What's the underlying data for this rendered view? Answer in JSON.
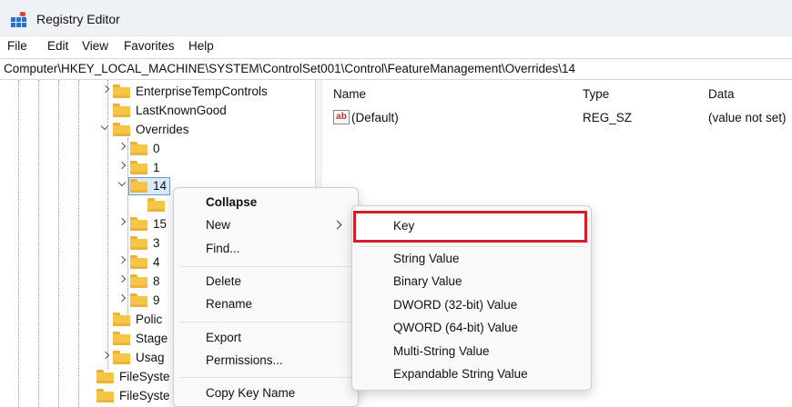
{
  "window": {
    "title": "Registry Editor"
  },
  "menu": [
    "File",
    "Edit",
    "View",
    "Favorites",
    "Help"
  ],
  "address": "Computer\\HKEY_LOCAL_MACHINE\\SYSTEM\\ControlSet001\\Control\\FeatureManagement\\Overrides\\14",
  "tree": {
    "enterprise": "EnterpriseTempControls",
    "lastknown": "LastKnownGood",
    "overrides": "Overrides",
    "k0": "0",
    "k1": "1",
    "k14": "14",
    "k15": "15",
    "k3": "3",
    "k4": "4",
    "k8": "8",
    "k9": "9",
    "polic": "Polic",
    "stage": "Stage",
    "usag": "Usag",
    "filesys1": "FileSyste",
    "filesys2": "FileSyste"
  },
  "values_pane": {
    "columns": {
      "name": "Name",
      "type": "Type",
      "data": "Data"
    },
    "rows": [
      {
        "name": "(Default)",
        "type": "REG_SZ",
        "data": "(value not set)",
        "icon": "string-value-icon"
      }
    ]
  },
  "context_menu": {
    "collapse": "Collapse",
    "new": "New",
    "find": "Find...",
    "delete": "Delete",
    "rename": "Rename",
    "export": "Export",
    "permissions": "Permissions...",
    "copy_key_name": "Copy Key Name"
  },
  "submenu": {
    "key": "Key",
    "string_value": "String Value",
    "binary_value": "Binary Value",
    "dword_value": "DWORD (32-bit) Value",
    "qword_value": "QWORD (64-bit) Value",
    "multi_string": "Multi-String Value",
    "expandable_string": "Expandable String Value"
  },
  "colors": {
    "highlight": "#d21f2b",
    "folder": "#f6c545",
    "selection": "#dbe9f9"
  }
}
